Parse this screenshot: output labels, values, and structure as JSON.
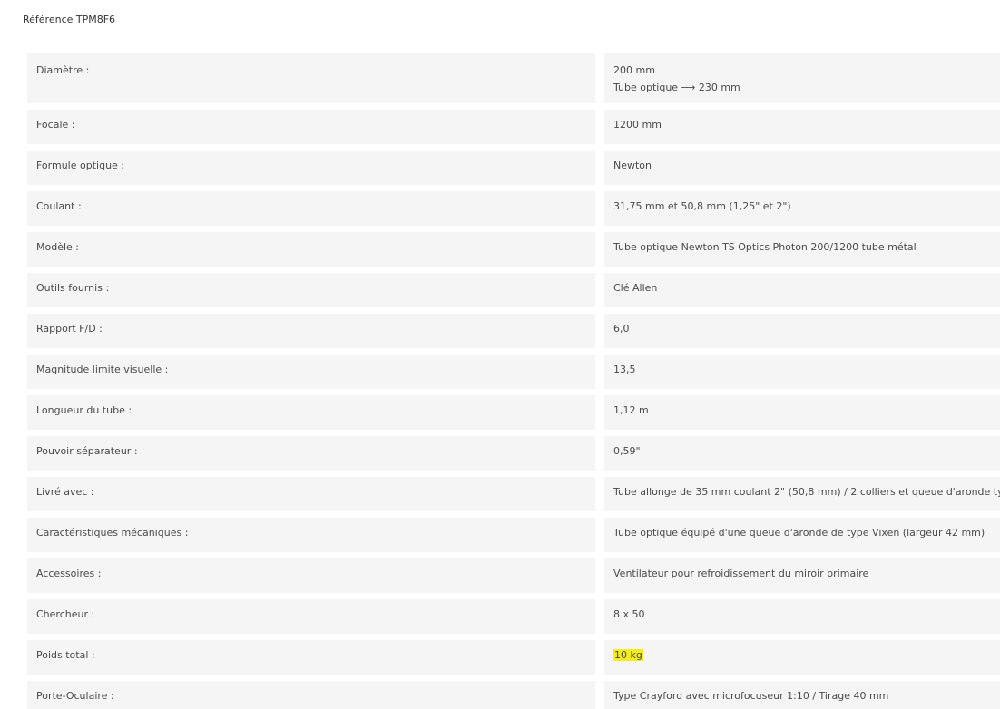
{
  "product": {
    "reference": "Référence TPM8F6"
  },
  "specs": [
    {
      "label": "Diamètre :",
      "value_lines": [
        "200 mm",
        "Tube optique ⟶ 230 mm"
      ]
    },
    {
      "label": "Focale :",
      "value": "1200 mm"
    },
    {
      "label": "Formule optique :",
      "value": "Newton"
    },
    {
      "label": "Coulant :",
      "value": "31,75 mm et 50,8 mm (1,25\" et 2\")"
    },
    {
      "label": "Modèle :",
      "value": "Tube optique Newton TS Optics Photon 200/1200 tube métal"
    },
    {
      "label": "Outils fournis :",
      "value": "Clé Allen"
    },
    {
      "label": "Rapport F/D :",
      "value": "6,0"
    },
    {
      "label": "Magnitude limite visuelle :",
      "value": "13,5"
    },
    {
      "label": "Longueur du tube :",
      "value": "1,12 m"
    },
    {
      "label": "Pouvoir séparateur :",
      "value": "0,59\""
    },
    {
      "label": "Livré avec :",
      "value": "Tube allonge de 35 mm coulant 2\" (50,8 mm) / 2 colliers et queue d'aronde ty"
    },
    {
      "label": "Caractéristiques mécaniques :",
      "value": "Tube optique équipé d'une queue d'aronde de type Vixen (largeur 42 mm)"
    },
    {
      "label": "Accessoires :",
      "value": "Ventilateur pour refroidissement du miroir primaire"
    },
    {
      "label": "Chercheur :",
      "value": "8 x 50"
    },
    {
      "label": "Poids total :",
      "value": "10 kg",
      "highlight_color": "#f4ee1e"
    },
    {
      "label": "Porte-Oculaire :",
      "value": "Type Crayford avec microfocuseur 1:10 / Tirage 40 mm"
    }
  ]
}
